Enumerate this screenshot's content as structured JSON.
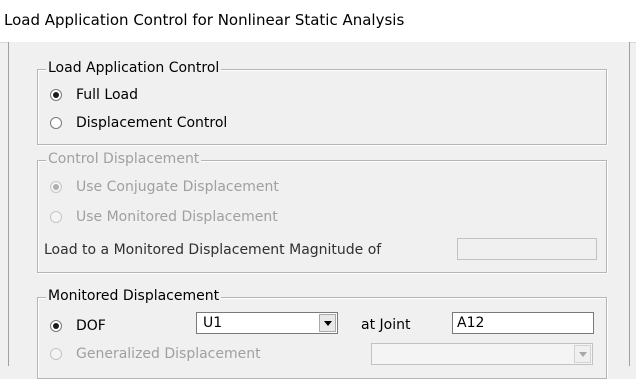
{
  "window": {
    "title": "Load Application Control for Nonlinear Static Analysis"
  },
  "load_application_control": {
    "legend": "Load Application Control",
    "full_load": {
      "label": "Full Load",
      "checked": true
    },
    "displacement_control": {
      "label": "Displacement Control",
      "checked": false
    }
  },
  "control_displacement": {
    "legend": "Control Displacement",
    "use_conjugate": {
      "label": "Use Conjugate Displacement",
      "checked": true
    },
    "use_monitored": {
      "label": "Use Monitored Displacement",
      "checked": false
    },
    "magnitude_label": "Load to a Monitored Displacement Magnitude of",
    "magnitude_value": ""
  },
  "monitored_displacement": {
    "legend": "Monitored Displacement",
    "dof": {
      "label": "DOF",
      "checked": true,
      "selected": "U1"
    },
    "at_joint_label": "at Joint",
    "joint_value": "A12",
    "generalized": {
      "label": "Generalized Displacement",
      "checked": false,
      "selected": ""
    }
  }
}
